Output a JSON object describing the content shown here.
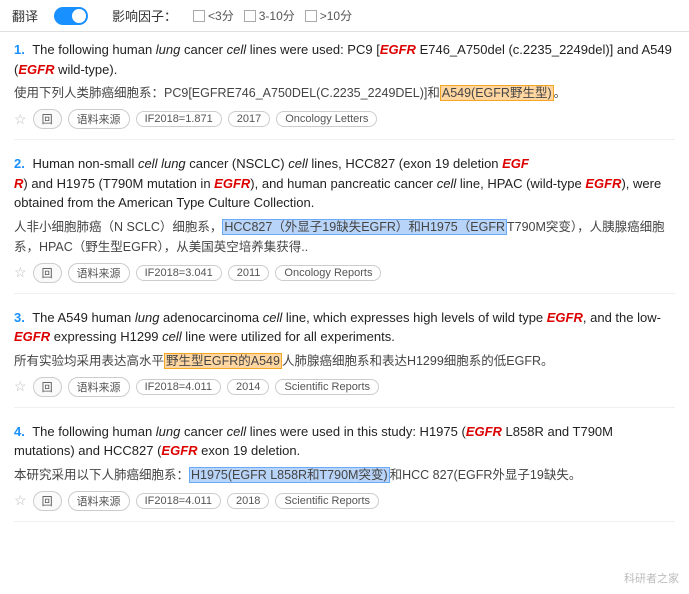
{
  "header": {
    "translate_label": "翻译",
    "toggle_on": true,
    "influence_label": "影响因子：",
    "filters": [
      {
        "label": "<3分",
        "checked": false
      },
      {
        "label": "3-10分",
        "checked": false
      },
      {
        "label": ">10分",
        "checked": false
      }
    ]
  },
  "results": [
    {
      "number": "1.",
      "en_parts": [
        {
          "text": "The following human ",
          "type": "normal"
        },
        {
          "text": "lung",
          "type": "italic"
        },
        {
          "text": " cancer ",
          "type": "normal"
        },
        {
          "text": "cell",
          "type": "italic"
        },
        {
          "text": " lines were used: PC9 [",
          "type": "normal"
        },
        {
          "text": "EGFR",
          "type": "gene"
        },
        {
          "text": " E746_A750del (c.2235_2249del)] and A549 (",
          "type": "normal"
        },
        {
          "text": "EGFR",
          "type": "gene"
        },
        {
          "text": " wild-type).",
          "type": "normal"
        }
      ],
      "cn": "使用下列人类肺癌细胞系：PC9[EGFRE746_A750DEL(C.2235_2249DEL)]和",
      "cn_highlight": "A549(EGFR野生型)。",
      "cn_highlight_type": "orange",
      "tags": [
        {
          "type": "star"
        },
        {
          "type": "circle",
          "label": "回"
        },
        {
          "type": "tag",
          "label": "语料来源"
        },
        {
          "type": "tag",
          "label": "IF2018=1.871"
        },
        {
          "type": "tag",
          "label": "2017"
        },
        {
          "type": "tag",
          "label": "Oncology Letters"
        }
      ]
    },
    {
      "number": "2.",
      "en_parts": [
        {
          "text": "Human non-small ",
          "type": "normal"
        },
        {
          "text": "cell lung",
          "type": "italic"
        },
        {
          "text": " cancer (NSCLC) ",
          "type": "normal"
        },
        {
          "text": "cell",
          "type": "italic"
        },
        {
          "text": " lines, HCC827 (exon 19 deletion ",
          "type": "normal"
        },
        {
          "text": "EGF R",
          "type": "gene"
        },
        {
          "text": ") and H1975 (T790M mutation in ",
          "type": "normal"
        },
        {
          "text": "EGFR",
          "type": "gene"
        },
        {
          "text": "), and human pancreatic cancer ",
          "type": "normal"
        },
        {
          "text": "cell",
          "type": "italic"
        },
        {
          "text": " line, HPAC (wild-type ",
          "type": "normal"
        },
        {
          "text": "EGFR",
          "type": "gene"
        },
        {
          "text": "), were obtained from the American Type Culture Collection.",
          "type": "normal"
        }
      ],
      "cn": "人非小细胞肺癌（N SCLC）细胞系，",
      "cn_highlight1": "HCC827（外显子19缺失EGFR）和H1975（EGFR",
      "cn_highlight1_type": "blue",
      "cn_mid": "T790M突变），人胰腺癌细胞系，HPAC（野生型EGFR），从美国英空培养集获得..",
      "tags": [
        {
          "type": "star"
        },
        {
          "type": "circle",
          "label": "回"
        },
        {
          "type": "tag",
          "label": "语料来源"
        },
        {
          "type": "tag",
          "label": "IF2018=3.041"
        },
        {
          "type": "tag",
          "label": "2011"
        },
        {
          "type": "tag",
          "label": "Oncology Reports"
        }
      ]
    },
    {
      "number": "3.",
      "en_parts": [
        {
          "text": "The A549 human ",
          "type": "normal"
        },
        {
          "text": "lung",
          "type": "italic"
        },
        {
          "text": " adenocarcinoma ",
          "type": "normal"
        },
        {
          "text": "cell",
          "type": "italic"
        },
        {
          "text": " line, which expresses high levels of wild type ",
          "type": "normal"
        },
        {
          "text": "EGFR",
          "type": "gene"
        },
        {
          "text": ", and the low-",
          "type": "normal"
        },
        {
          "text": "EGFR",
          "type": "gene"
        },
        {
          "text": " expressing H1299 ",
          "type": "normal"
        },
        {
          "text": "cell",
          "type": "italic"
        },
        {
          "text": " line were utilized for all experiments.",
          "type": "normal"
        }
      ],
      "cn": "所有实验均采用表达高水平",
      "cn_highlight": "野生型EGFR的A549",
      "cn_highlight_type": "orange",
      "cn_end": "人肺腺癌细胞系和表达H1299细胞系的低EGFR。",
      "tags": [
        {
          "type": "star"
        },
        {
          "type": "circle",
          "label": "回"
        },
        {
          "type": "tag",
          "label": "语料来源"
        },
        {
          "type": "tag",
          "label": "IF2018=4.011"
        },
        {
          "type": "tag",
          "label": "2014"
        },
        {
          "type": "tag",
          "label": "Scientific Reports"
        }
      ]
    },
    {
      "number": "4.",
      "en_parts": [
        {
          "text": "The following human ",
          "type": "normal"
        },
        {
          "text": "lung",
          "type": "italic"
        },
        {
          "text": " cancer ",
          "type": "normal"
        },
        {
          "text": "cell",
          "type": "italic"
        },
        {
          "text": " lines were used in this study: H1975 (",
          "type": "normal"
        },
        {
          "text": "EGFR",
          "type": "gene"
        },
        {
          "text": " L858R and T790M mutations) and HCC827 (",
          "type": "normal"
        },
        {
          "text": "EGFR",
          "type": "gene"
        },
        {
          "text": " exon 19 deletion.",
          "type": "normal"
        }
      ],
      "cn": "本研究采用以下人肺癌细胞系：",
      "cn_highlight": "H1975(EGFR L858R和T790M突变)",
      "cn_highlight_type": "blue",
      "cn_end": "和HCC 827(EGFR外显子19缺失。",
      "tags": [
        {
          "type": "star"
        },
        {
          "type": "circle",
          "label": "回"
        },
        {
          "type": "tag",
          "label": "语料来源"
        },
        {
          "type": "tag",
          "label": "IF2018=4.011"
        },
        {
          "type": "tag",
          "label": "2018"
        },
        {
          "type": "tag",
          "label": "Scientific Reports"
        }
      ]
    }
  ],
  "watermark": "科研者之家"
}
